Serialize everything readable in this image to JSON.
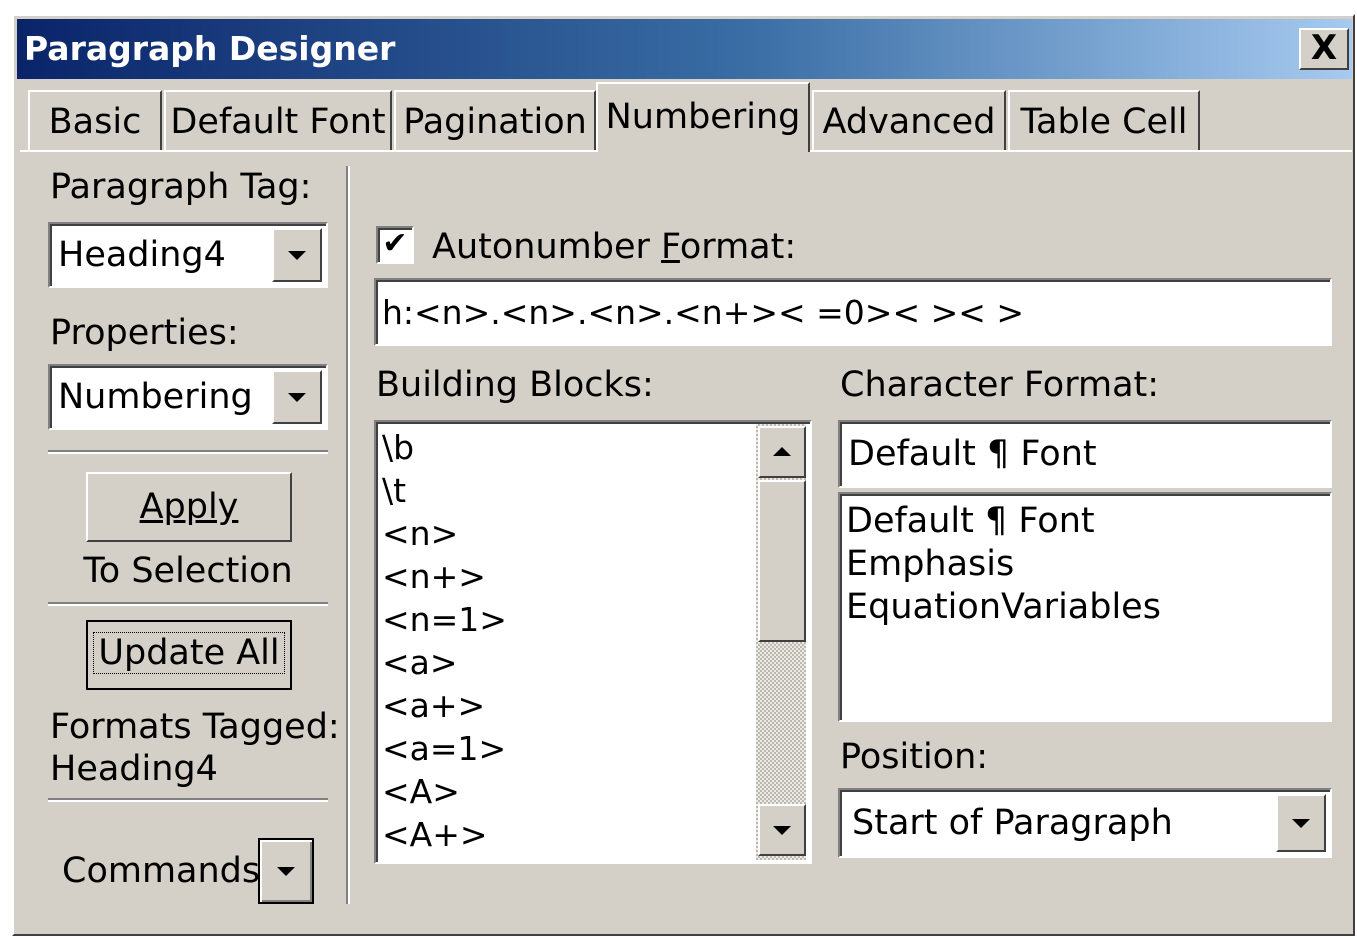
{
  "window": {
    "title": "Paragraph Designer",
    "close_label": "X"
  },
  "tabs": [
    {
      "label": "Basic"
    },
    {
      "label": "Default Font"
    },
    {
      "label": "Pagination"
    },
    {
      "label": "Numbering",
      "active": true
    },
    {
      "label": "Advanced"
    },
    {
      "label": "Table Cell"
    }
  ],
  "left": {
    "paragraph_tag_label": "Paragraph Tag:",
    "paragraph_tag_value": "Heading4",
    "properties_label": "Properties:",
    "properties_value": "Numbering",
    "apply_label": "Apply",
    "to_selection_label": "To Selection",
    "update_all_label": "Update All",
    "formats_tagged_label": "Formats Tagged:",
    "formats_tagged_value": "Heading4",
    "commands_label": "Commands:"
  },
  "numbering": {
    "autonumber_checked": true,
    "autonumber_label": "Autonumber Format:",
    "autonumber_value": "h:<n>.<n>.<n>.<n+>< =0>< >< >",
    "building_blocks_label": "Building Blocks:",
    "building_blocks": [
      "\\b",
      "\\t",
      "<n>",
      "<n+>",
      "<n=1>",
      "<a>",
      "<a+>",
      "<a=1>",
      "<A>",
      "<A+>"
    ],
    "character_format_label": "Character Format:",
    "character_format_value": "Default ¶ Font",
    "character_formats": [
      "Default ¶ Font",
      "Emphasis",
      "EquationVariables"
    ],
    "position_label": "Position:",
    "position_value": "Start of Paragraph"
  }
}
